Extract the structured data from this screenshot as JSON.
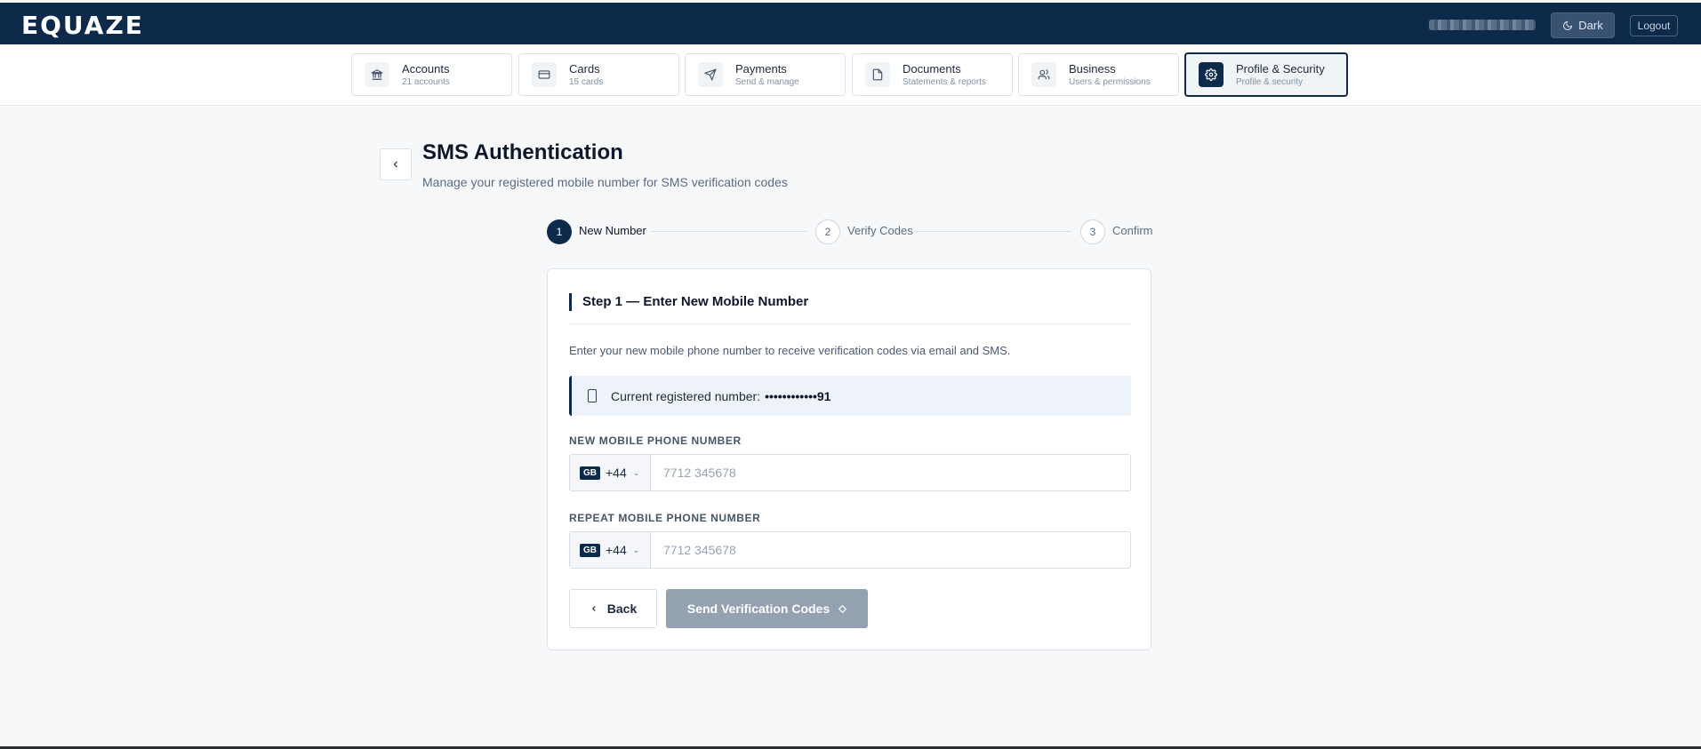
{
  "header": {
    "logo": "EQUAZE",
    "theme_button": "Dark",
    "logout_button": "Logout"
  },
  "nav": {
    "tabs": [
      {
        "label": "Accounts",
        "sub": "21 accounts",
        "icon": "bank-icon"
      },
      {
        "label": "Cards",
        "sub": "15 cards",
        "icon": "card-icon"
      },
      {
        "label": "Payments",
        "sub": "Send & manage",
        "icon": "send-icon"
      },
      {
        "label": "Documents",
        "sub": "Statements & reports",
        "icon": "document-icon"
      },
      {
        "label": "Business",
        "sub": "Users & permissions",
        "icon": "users-icon"
      },
      {
        "label": "Profile & Security",
        "sub": "Profile & security",
        "icon": "gear-icon",
        "active": true
      }
    ]
  },
  "page": {
    "title": "SMS Authentication",
    "subtitle": "Manage your registered mobile number for SMS verification codes"
  },
  "stepper": {
    "steps": [
      {
        "number": "1",
        "label": "New Number",
        "state": "active"
      },
      {
        "number": "2",
        "label": "Verify Codes",
        "state": "pending"
      },
      {
        "number": "3",
        "label": "Confirm",
        "state": "pending"
      }
    ]
  },
  "card": {
    "title": "Step 1 — Enter New Mobile Number",
    "description": "Enter your new mobile phone number to receive verification codes via email and SMS.",
    "current_label": "Current registered number:",
    "current_value": "••••••••••••91",
    "new_label": "NEW MOBILE PHONE NUMBER",
    "repeat_label": "REPEAT MOBILE PHONE NUMBER",
    "country_flag": "GB",
    "country_code": "+44",
    "placeholder": "7712 345678",
    "back_button": "Back",
    "send_button": "Send Verification Codes"
  },
  "colors": {
    "navy": "#0d2a4a",
    "disabled_button": "#94a1b1",
    "background": "#f6f8fa"
  }
}
